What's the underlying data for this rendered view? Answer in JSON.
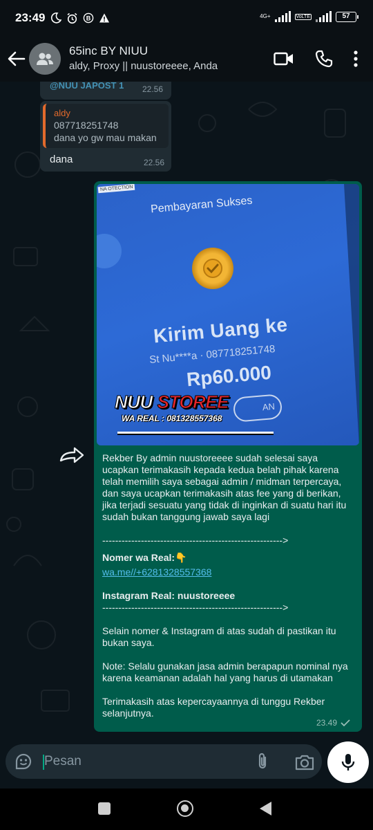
{
  "status_bar": {
    "time": "23:49",
    "icons": [
      "moon-icon",
      "alarm-icon",
      "b-badge-icon",
      "warning-icon"
    ],
    "network_label": "4G+",
    "volte": "VoLTE",
    "battery": "57"
  },
  "header": {
    "title": "65inc BY NIUU",
    "subtitle": "aldy, Proxy || nuustoreeee, Anda"
  },
  "messages": {
    "in1": {
      "text": "@NUU JAPOST 1",
      "time": "22.56"
    },
    "in2": {
      "quote_name": "aldy",
      "quote_lines": [
        "087718251748",
        "dana yo gw mau makan"
      ],
      "body": "dana",
      "time": "22.56"
    },
    "out": {
      "photo": {
        "corner_tag": "NA OTECTION",
        "heading": "Pembayaran Sukses",
        "kirim": "Kirim Uang ke",
        "account": "St Nu****a · 087718251748",
        "amount": "Rp60.000",
        "oval_text": "AN",
        "watermark_a": "NUU",
        "watermark_b": "STOREE",
        "watermark_sub": "WA REAL : 081328557368"
      },
      "para1": "Rekber By admin nuustoreeee sudah selesai saya ucapkan terimakasih kepada kedua belah pihak karena telah memilih saya sebagai admin / midman terpercaya, dan saya ucapkan terimakasih atas fee yang di berikan, jika terjadi sesuatu yang tidak di inginkan di suatu hari itu sudah bukan tanggung jawab saya lagi",
      "divider": "-------------------------------------------------------->",
      "wa_label": "Nomer wa Real:👇",
      "wa_link": "wa.me//+6281328557368",
      "ig_label": "Instagram Real: nuustoreeee",
      "para2": "Selain nomer & Instagram di atas sudah di pastikan itu bukan saya.",
      "para3": "Note: Selalu gunakan jasa admin berapapun nominal nya karena keamanan adalah hal yang harus di utamakan",
      "para4": "Terimakasih atas kepercayaannya di tunggu Rekber selanjutnya.",
      "time": "23.49"
    }
  },
  "composer": {
    "placeholder": "Pesan"
  },
  "colors": {
    "accent": "#00a884",
    "outgoing_bubble": "#005c4b",
    "incoming_bubble": "#202c33",
    "quote_bar": "#e26a2c",
    "link": "#53bdeb"
  }
}
